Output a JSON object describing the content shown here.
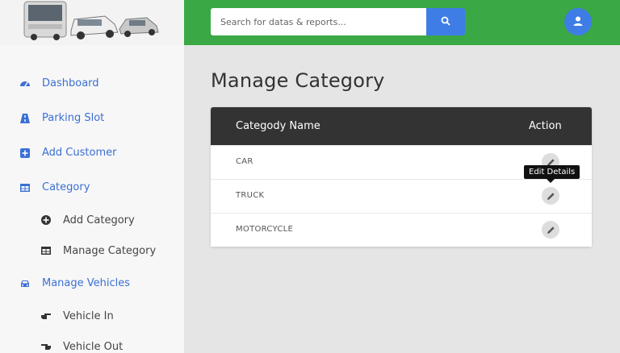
{
  "search": {
    "placeholder": "Search for datas & reports..."
  },
  "sidebar": {
    "items": [
      {
        "label": "Dashboard",
        "icon": "tachometer-icon"
      },
      {
        "label": "Parking Slot",
        "icon": "road-icon"
      },
      {
        "label": "Add Customer",
        "icon": "plus-square-icon"
      },
      {
        "label": "Category",
        "icon": "table-icon"
      },
      {
        "label": "Add Category",
        "icon": "plus-circle-icon",
        "sub": true
      },
      {
        "label": "Manage Category",
        "icon": "table-icon",
        "sub": true
      },
      {
        "label": "Manage Vehicles",
        "icon": "car-icon"
      },
      {
        "label": "Vehicle In",
        "icon": "hand-right-icon",
        "sub": true
      },
      {
        "label": "Vehicle Out",
        "icon": "hand-left-icon",
        "sub": true
      }
    ]
  },
  "main": {
    "title": "Manage Category",
    "table": {
      "headers": {
        "name": "Categody Name",
        "action": "Action"
      },
      "rows": [
        {
          "name": "CAR"
        },
        {
          "name": "TRUCK"
        },
        {
          "name": "MOTORCYCLE"
        }
      ]
    },
    "tooltip": "Edit Details"
  },
  "colors": {
    "topbar": "#3aa845",
    "accent": "#3e7de6",
    "header": "#333333",
    "link": "#3b6fd4"
  }
}
